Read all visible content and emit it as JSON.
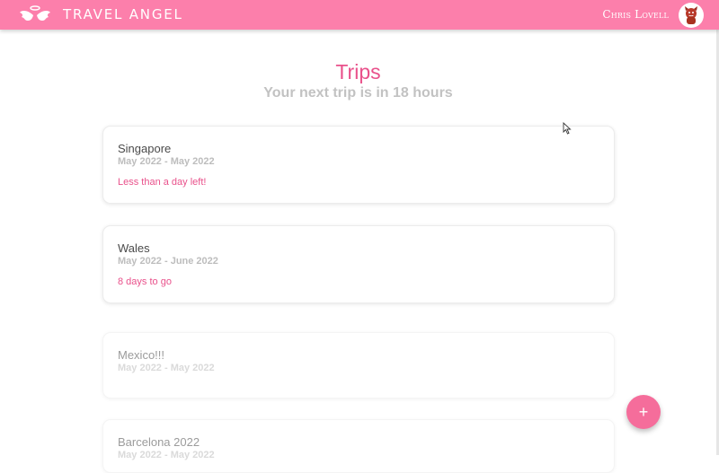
{
  "header": {
    "brand": "TRAVEL ANGEL",
    "logo_icon": "angel-wings-icon",
    "user_name": "Chris Lovell",
    "avatar_icon": "devil-avatar-icon",
    "background_color": "#fc7fab"
  },
  "main": {
    "title": "Trips",
    "subtitle": "Your next trip is in 18 hours",
    "accent_color": "#e9518b"
  },
  "trips": [
    {
      "name": "Singapore",
      "dates": "May 2022 - May 2022",
      "countdown": "Less than a day left!"
    },
    {
      "name": "Wales",
      "dates": "May 2022 - June 2022",
      "countdown": "8 days to go"
    },
    {
      "name": "Mexico!!!",
      "dates": "May 2022 - May 2022",
      "countdown": ""
    },
    {
      "name": "Barcelona 2022",
      "dates": "May 2022 - May 2022",
      "countdown": ""
    }
  ],
  "fab": {
    "label": "+",
    "icon": "plus-icon"
  }
}
